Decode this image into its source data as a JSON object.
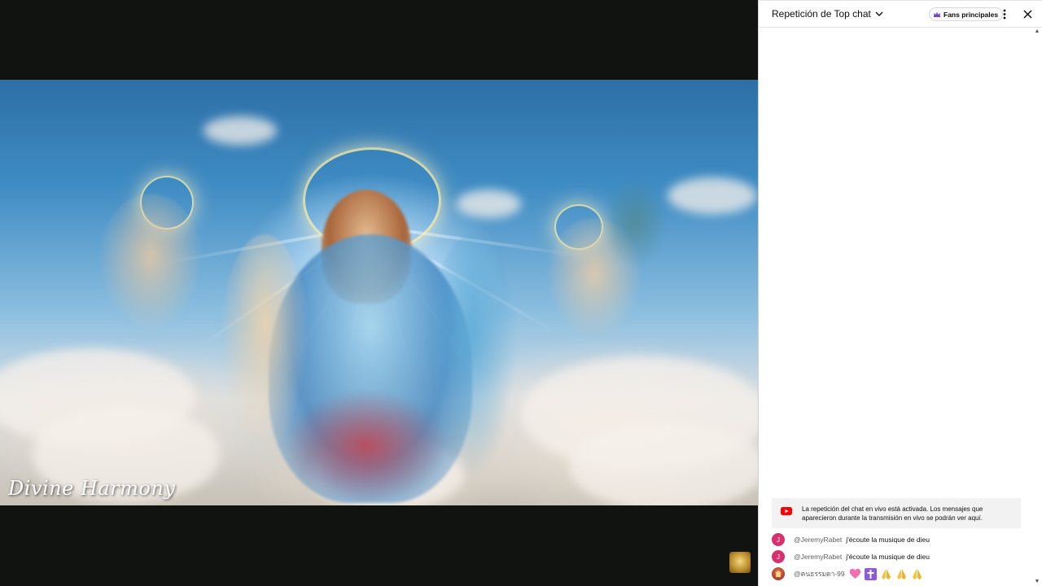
{
  "video": {
    "watermark": "Divine Harmony"
  },
  "chat": {
    "title": "Repetición de Top chat",
    "fans_label": "Fans principales",
    "replay_notice": "La repetición del chat en vivo está activada. Los mensajes que aparecieron durante la transmisión en vivo se podrán ver aquí.",
    "messages": [
      {
        "avatar_letter": "J",
        "avatar_color": "#d6306f",
        "author": "@JeremyRabet",
        "text": "j'écoute la musique de dieu"
      },
      {
        "avatar_letter": "J",
        "avatar_color": "#d6306f",
        "author": "@JeremyRabet",
        "text": "j'écoute la musique de dieu"
      },
      {
        "avatar_color": "#b23a2c",
        "author": "@คนธรรมดา-99",
        "emojis": [
          "pink-heart-emoji",
          "latin-cross-emoji",
          "folded-hands-emoji",
          "folded-hands-emoji",
          "folded-hands-emoji"
        ]
      }
    ]
  },
  "colors": {
    "accent_red": "#ff0000",
    "crown_purple": "#7e3fd6"
  }
}
